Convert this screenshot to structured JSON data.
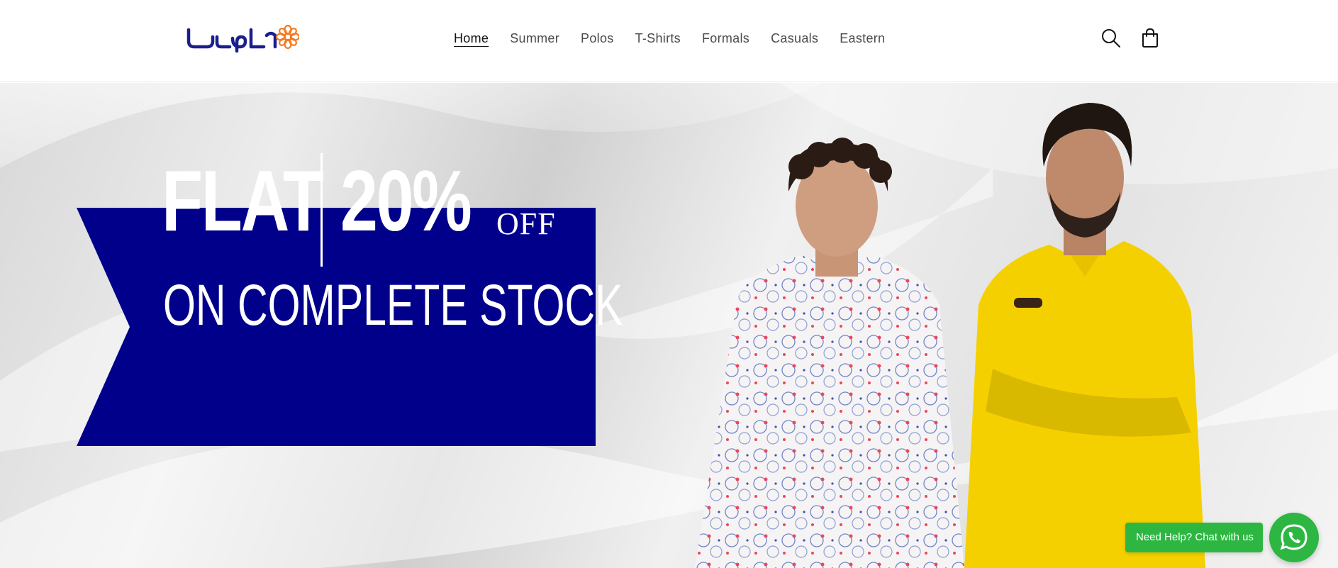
{
  "header": {
    "logo_icon": "flower-logo-icon",
    "nav": [
      {
        "label": "Home",
        "active": true
      },
      {
        "label": "Summer"
      },
      {
        "label": "Polos"
      },
      {
        "label": "T-Shirts"
      },
      {
        "label": "Formals"
      },
      {
        "label": "Casuals"
      },
      {
        "label": "Eastern"
      }
    ],
    "icons": [
      "search-icon",
      "cart-icon"
    ]
  },
  "hero": {
    "banner_color": "#00008b",
    "line1_left": "FLAT",
    "line1_right": "20%",
    "line1_suffix": "OFF",
    "line2": "ON COMPLETE STOCK"
  },
  "chat": {
    "label": "Need Help? Chat with us",
    "color": "#2db742",
    "icon": "whatsapp-icon"
  },
  "colors": {
    "logo_blue": "#1a1f8c",
    "logo_orange": "#f47a20",
    "banner_blue": "#00008b"
  }
}
